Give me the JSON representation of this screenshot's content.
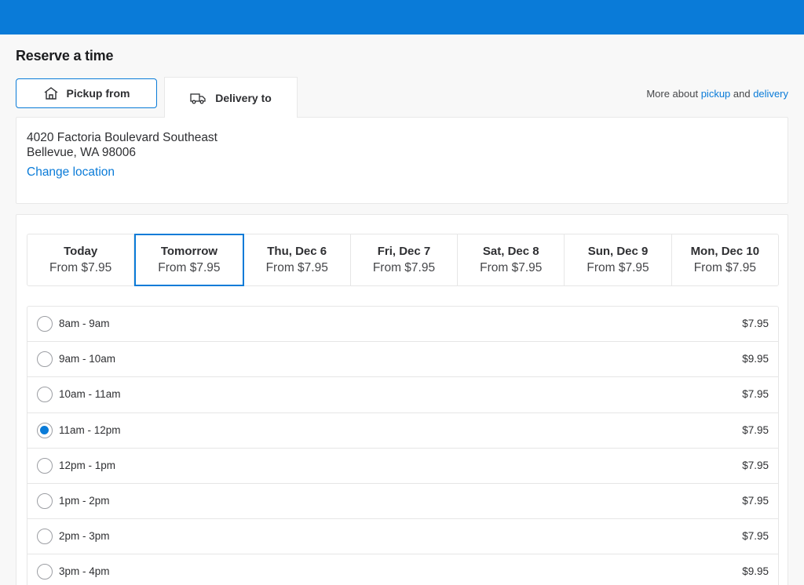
{
  "page": {
    "title": "Reserve a time"
  },
  "colors": {
    "accent": "#0a7bd8",
    "topbar": "#0a7bd8"
  },
  "tabs": {
    "pickup": {
      "label": "Pickup from",
      "icon": "store-icon"
    },
    "delivery": {
      "label": "Delivery to",
      "icon": "truck-icon",
      "active": true
    }
  },
  "more_about": {
    "prefix": "More about ",
    "pickup_link": "pickup",
    "and": " and ",
    "delivery_link": "delivery"
  },
  "address": {
    "line1": "4020 Factoria Boulevard Southeast",
    "line2": "Bellevue, WA 98006",
    "change_link": "Change location"
  },
  "days": [
    {
      "name": "Today",
      "price": "From $7.95",
      "selected": false
    },
    {
      "name": "Tomorrow",
      "price": "From $7.95",
      "selected": true
    },
    {
      "name": "Thu, Dec 6",
      "price": "From $7.95",
      "selected": false
    },
    {
      "name": "Fri, Dec 7",
      "price": "From $7.95",
      "selected": false
    },
    {
      "name": "Sat, Dec 8",
      "price": "From $7.95",
      "selected": false
    },
    {
      "name": "Sun, Dec 9",
      "price": "From $7.95",
      "selected": false
    },
    {
      "name": "Mon, Dec 10",
      "price": "From $7.95",
      "selected": false
    }
  ],
  "slots": [
    {
      "time": "8am - 9am",
      "price": "$7.95",
      "selected": false
    },
    {
      "time": "9am - 10am",
      "price": "$9.95",
      "selected": false
    },
    {
      "time": "10am - 11am",
      "price": "$7.95",
      "selected": false
    },
    {
      "time": "11am - 12pm",
      "price": "$7.95",
      "selected": true
    },
    {
      "time": "12pm - 1pm",
      "price": "$7.95",
      "selected": false
    },
    {
      "time": "1pm - 2pm",
      "price": "$7.95",
      "selected": false
    },
    {
      "time": "2pm - 3pm",
      "price": "$7.95",
      "selected": false
    },
    {
      "time": "3pm - 4pm",
      "price": "$9.95",
      "selected": false
    }
  ]
}
